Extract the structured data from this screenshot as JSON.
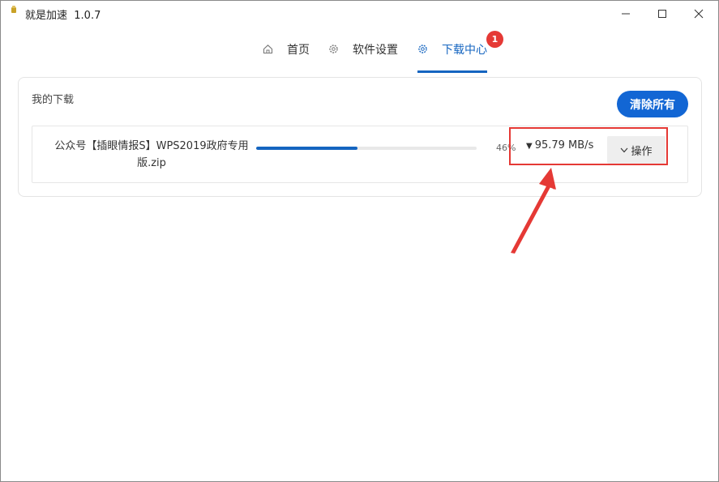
{
  "window": {
    "title": "就是加速",
    "version": "1.0.7"
  },
  "tabs": [
    {
      "label": "首页",
      "icon": "home-icon"
    },
    {
      "label": "软件设置",
      "icon": "gear-icon"
    },
    {
      "label": "下载中心",
      "icon": "gear-icon",
      "active": true
    }
  ],
  "badge": "1",
  "downloads": {
    "title": "我的下载",
    "clear_label": "清除所有",
    "item": {
      "name_line1": "公众号【插眼情报S】WPS2019政府专用",
      "name_line2": "版.zip",
      "progress": 46,
      "percent_text": "46%",
      "speed": "95.79 MB/s",
      "action_label": "操作"
    }
  },
  "colors": {
    "accent": "#1565c0",
    "badge": "#e53935",
    "annotation": "#e53935"
  }
}
